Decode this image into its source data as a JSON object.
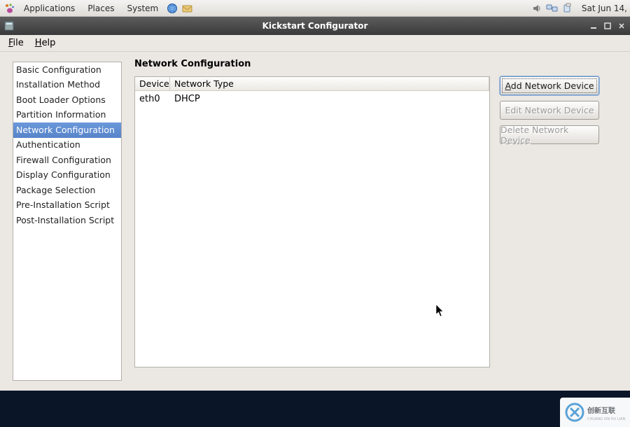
{
  "panel": {
    "menus": [
      "Applications",
      "Places",
      "System"
    ],
    "clock": "Sat Jun 14,"
  },
  "window": {
    "title": "Kickstart Configurator",
    "menubar": {
      "file": "File",
      "help": "Help"
    }
  },
  "sidebar": {
    "items": [
      "Basic Configuration",
      "Installation Method",
      "Boot Loader Options",
      "Partition Information",
      "Network Configuration",
      "Authentication",
      "Firewall Configuration",
      "Display Configuration",
      "Package Selection",
      "Pre-Installation Script",
      "Post-Installation Script"
    ],
    "selected": 4
  },
  "main": {
    "title": "Network Configuration",
    "columns": {
      "device": "Device",
      "type": "Network Type"
    },
    "rows": [
      {
        "device": "eth0",
        "type": "DHCP"
      }
    ],
    "buttons": {
      "add": "Add Network Device",
      "edit": "Edit Network Device",
      "delete": "Delete Network Device"
    }
  }
}
